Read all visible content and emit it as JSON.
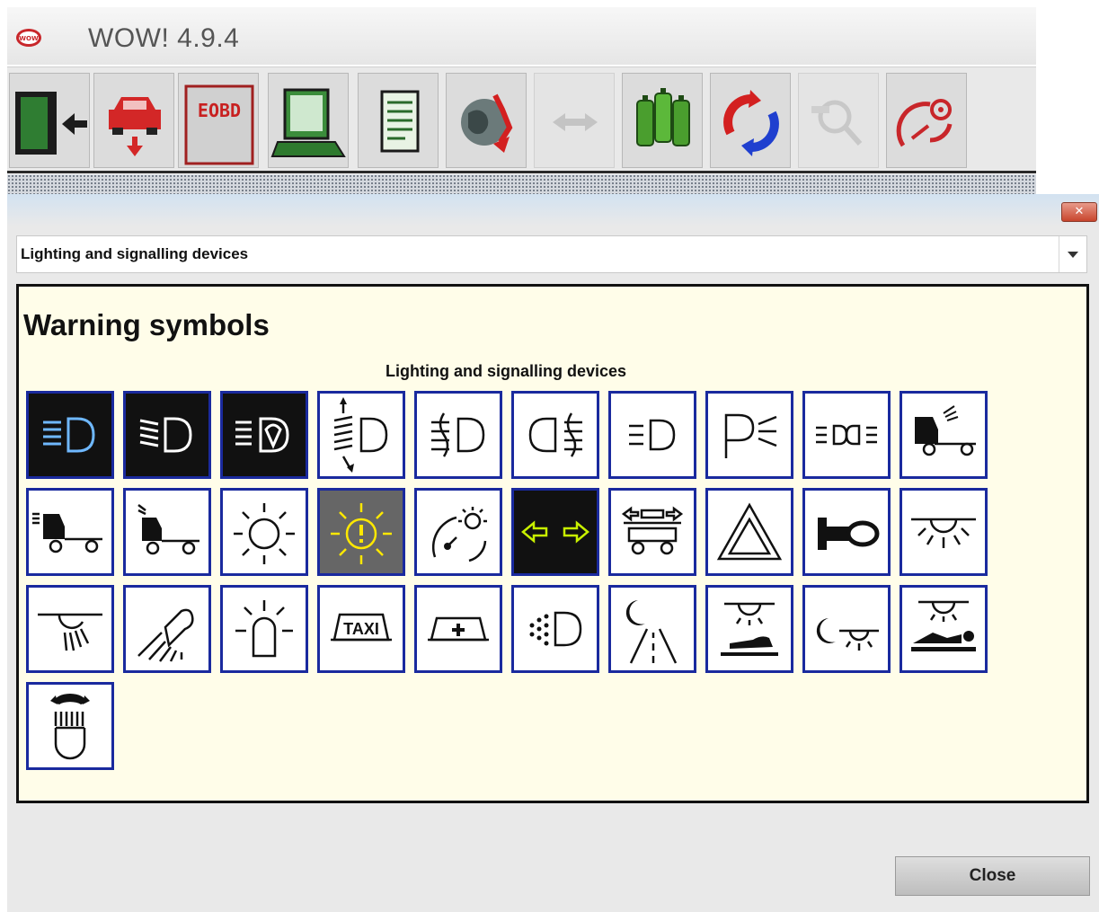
{
  "window": {
    "title": "WOW! 4.9.4",
    "logo_icon": "wow-logo-icon"
  },
  "toolbar": {
    "buttons": [
      {
        "name": "exit-button",
        "icon": "door-exit-icon",
        "enabled": true
      },
      {
        "name": "vehicle-select-button",
        "icon": "car-download-icon",
        "enabled": true
      },
      {
        "name": "eobd-button",
        "icon": "eobd-icon",
        "label": "EOBD",
        "enabled": true
      },
      {
        "name": "diagnostics-button",
        "icon": "laptop-icon",
        "enabled": true
      },
      {
        "name": "document-button",
        "icon": "document-icon",
        "enabled": true
      },
      {
        "name": "globe-update-button",
        "icon": "globe-arrow-icon",
        "enabled": true
      },
      {
        "name": "connection-button",
        "icon": "arrows-icon",
        "enabled": false
      },
      {
        "name": "batteries-button",
        "icon": "batteries-icon",
        "enabled": true
      },
      {
        "name": "sync-button",
        "icon": "sync-arrows-icon",
        "enabled": true
      },
      {
        "name": "search-vehicle-button",
        "icon": "magnifier-car-icon",
        "enabled": false
      },
      {
        "name": "gauge-settings-button",
        "icon": "gauge-gear-icon",
        "enabled": true
      }
    ]
  },
  "dialog": {
    "category_select_value": "Lighting and signalling devices",
    "panel_title": "Warning symbols",
    "group_label": "Lighting and signalling devices",
    "close_label": "Close",
    "symbols": [
      "main-beam-icon",
      "dipped-beam-icon",
      "headlamp-wash-icon",
      "headlamp-leveling-icon",
      "front-fog-lamp-icon",
      "rear-fog-lamp-icon",
      "position-lamp-icon",
      "parking-light-icon",
      "side-marker-lamps-icon",
      "spot-light-truck-icon",
      "truck-front-light-icon",
      "truck-beacon-light-icon",
      "interior-light-icon",
      "light-failure-warning-icon",
      "instrument-illumination-icon",
      "turn-signal-arrows-icon",
      "trailer-turn-signal-icon",
      "hazard-warning-icon",
      "horn-icon",
      "dome-light-icon",
      "work-light-icon",
      "searchlight-icon",
      "rotating-beacon-icon",
      "taxi-sign-icon",
      "ambulance-sign-icon",
      "daytime-running-light-icon",
      "night-road-light-icon",
      "footwell-light-icon",
      "night-interior-light-icon",
      "bunk-light-icon",
      "adjustable-lamp-icon"
    ]
  }
}
